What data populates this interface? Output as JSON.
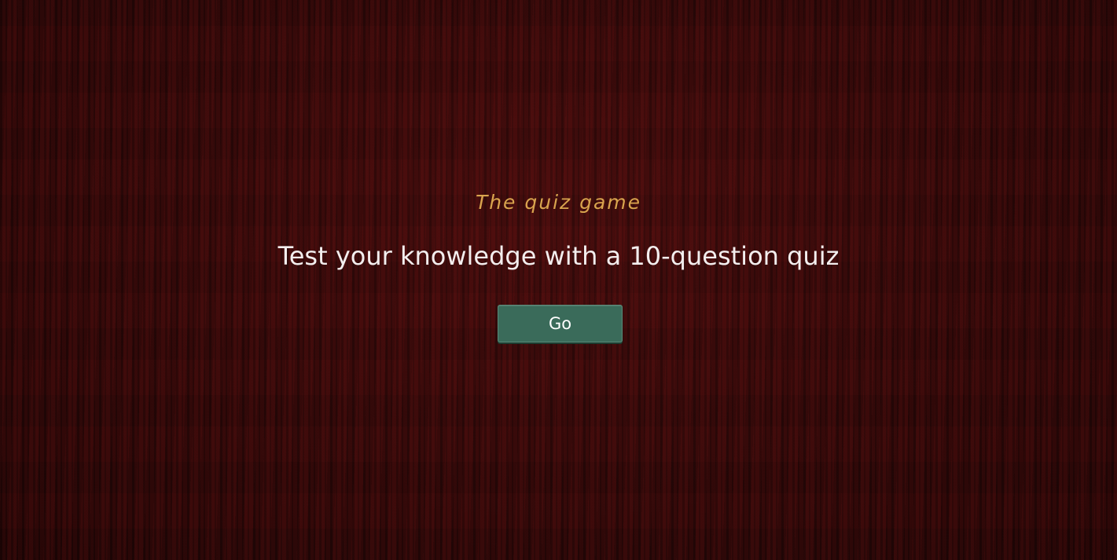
{
  "intro": {
    "subtitle": "The quiz game",
    "headline": "Test your knowledge with a 10-question quiz",
    "go_button_label": "Go"
  },
  "colors": {
    "background": "#360a0a",
    "subtitle": "#d9a44e",
    "headline": "#f3eeee",
    "button": "#3a6b5a",
    "button_text": "#ffffff"
  }
}
